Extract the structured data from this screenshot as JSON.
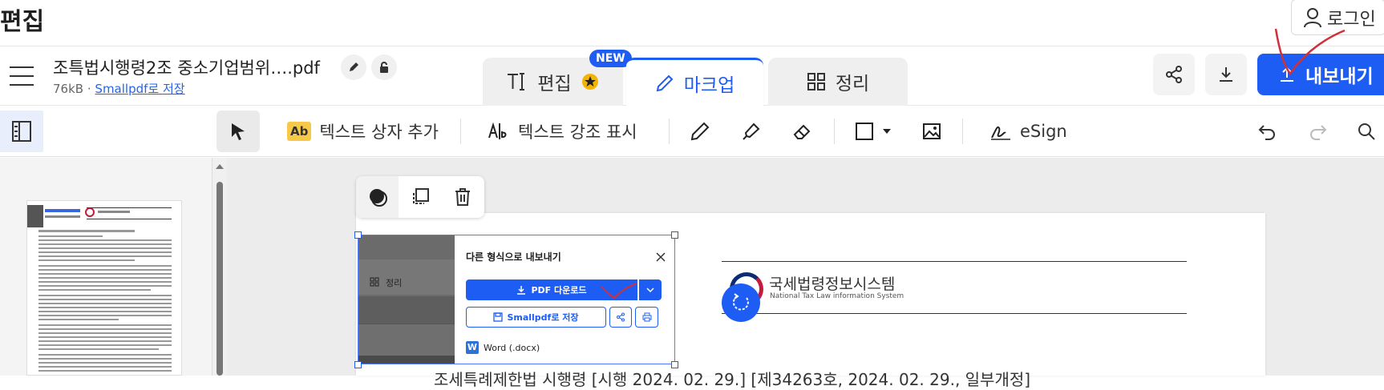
{
  "app": {
    "title": "편집",
    "login_label": "로그인"
  },
  "file": {
    "name": "조특법시행령2조 중소기업범위….pdf",
    "size": "76kB",
    "separator": "·",
    "save_link": "Smallpdf로 저장"
  },
  "tabs": [
    {
      "label": "편집",
      "badge": "NEW"
    },
    {
      "label": "마크업"
    },
    {
      "label": "정리"
    }
  ],
  "header_actions": {
    "export_label": "내보내기"
  },
  "toolbar": {
    "add_textbox": "텍스트 상자 추가",
    "highlight_text": "텍스트 강조 표시",
    "esign": "eSign",
    "ab_glyph": "Ab"
  },
  "export_dialog": {
    "title": "다른 형식으로 내보내기",
    "download_pdf": "PDF 다운로드",
    "save_smallpdf": "Smallpdf로 저장",
    "word_option": "Word (.docx)",
    "organize_label": "정리"
  },
  "document": {
    "logo_title": "국세법령정보시스템",
    "logo_subtitle": "National Tax Law information System",
    "body_line": "조세특례제한법 시행령 [시행 2024. 02. 29.] [제34263호, 2024. 02. 29., 일부개정]"
  },
  "colors": {
    "accent": "#1d5df4",
    "annotation_red": "#d0303a"
  }
}
